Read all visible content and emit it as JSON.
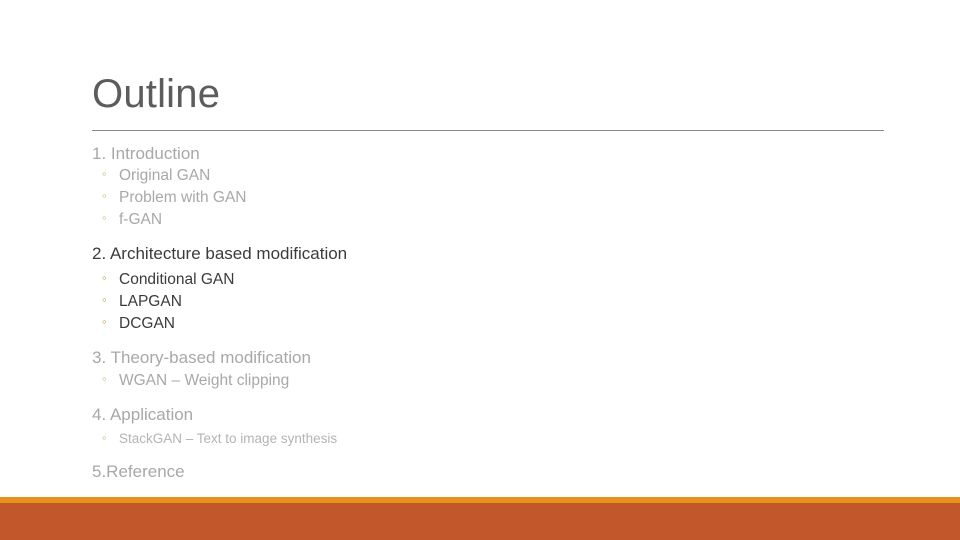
{
  "slide": {
    "title": "Outline",
    "accent_thin_color": "#e8921d",
    "accent_thick_color": "#c1572b",
    "rule_color": "#8a8a8a",
    "muted_text_color": "#a8a8a8",
    "emphasis_text_color": "#3b3b3b",
    "bullet_color": "#c9b17a"
  },
  "outline": {
    "sections": [
      {
        "heading": "1. Introduction",
        "items": [
          "Original GAN",
          "Problem with GAN",
          "f-GAN"
        ]
      },
      {
        "heading": "2. Architecture based modification",
        "items": [
          "Conditional GAN",
          "LAPGAN",
          "DCGAN"
        ]
      },
      {
        "heading": "3. Theory-based modification",
        "items": [
          "WGAN – Weight clipping"
        ]
      },
      {
        "heading": "4. Application",
        "items": [
          "StackGAN – Text to image synthesis"
        ]
      },
      {
        "heading": "5.Reference",
        "items": []
      }
    ],
    "bullet_glyph": "◦"
  }
}
